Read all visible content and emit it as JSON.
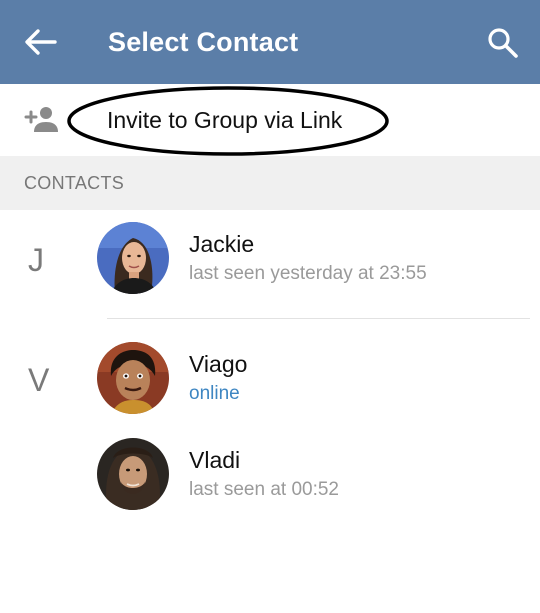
{
  "appbar": {
    "title": "Select Contact",
    "back_icon": "arrow-left-icon",
    "search_icon": "search-icon",
    "color": "#5b7ea8"
  },
  "invite": {
    "label": "Invite to Group via Link",
    "icon": "add-person-icon"
  },
  "section": {
    "label": "CONTACTS"
  },
  "groups": [
    {
      "letter": "J",
      "contacts": [
        {
          "name": "Jackie",
          "status": "last seen yesterday at 23:55",
          "online": false
        }
      ]
    },
    {
      "letter": "V",
      "contacts": [
        {
          "name": "Viago",
          "status": "online",
          "online": true
        },
        {
          "name": "Vladi",
          "status": "last seen at 00:52",
          "online": false
        }
      ]
    }
  ],
  "colors": {
    "online": "#3e86c2",
    "muted": "#9a9a9a"
  }
}
